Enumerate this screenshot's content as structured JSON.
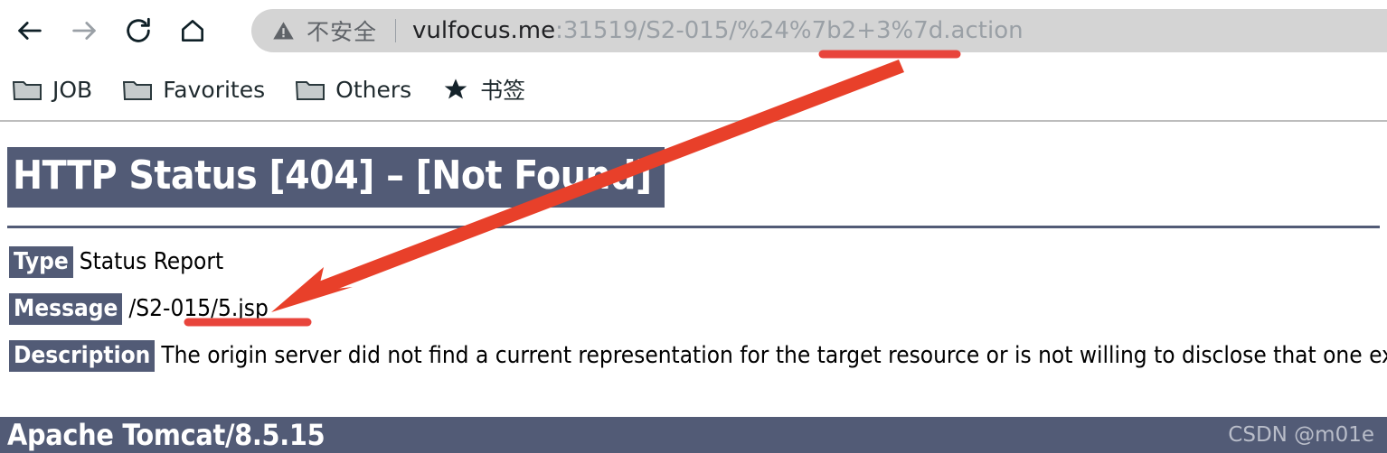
{
  "browser": {
    "nav": [
      {
        "name": "back",
        "icon": "arrow-left-icon",
        "state": "enabled"
      },
      {
        "name": "forward",
        "icon": "arrow-right-icon",
        "state": "disabled"
      },
      {
        "name": "reload",
        "icon": "reload-icon",
        "state": "enabled"
      },
      {
        "name": "home",
        "icon": "home-icon",
        "state": "enabled"
      }
    ],
    "omnibox": {
      "security_icon": "warning-triangle-icon",
      "security_label": "不安全",
      "url_host": "vulfocus.me",
      "url_path": ":31519/S2-015/%24%7b2+3%7d.action",
      "url_full": "vulfocus.me:31519/S2-015/%24%7b2+3%7d.action"
    },
    "bookmarks": [
      {
        "label": "JOB",
        "icon": "folder-icon"
      },
      {
        "label": "Favorites",
        "icon": "folder-icon"
      },
      {
        "label": "Others",
        "icon": "folder-icon"
      },
      {
        "label": "书签",
        "icon": "star-icon"
      }
    ]
  },
  "page": {
    "status_heading": "HTTP Status [404] – [Not Found]",
    "rows": [
      {
        "label": "Type",
        "value": "Status Report"
      },
      {
        "label": "Message",
        "value": "/S2-015/5.jsp"
      },
      {
        "label": "Description",
        "value": "The origin server did not find a current representation for the target resource or is not willing to disclose that one exists."
      }
    ],
    "footer_title": "Apache Tomcat/8.5.15",
    "watermark": "CSDN @m01e"
  },
  "colors": {
    "banner": "#525B76",
    "annotation_red": "#E8402A",
    "underline_red": "#E8453C",
    "omnibox_bg": "#d4d4d4"
  }
}
